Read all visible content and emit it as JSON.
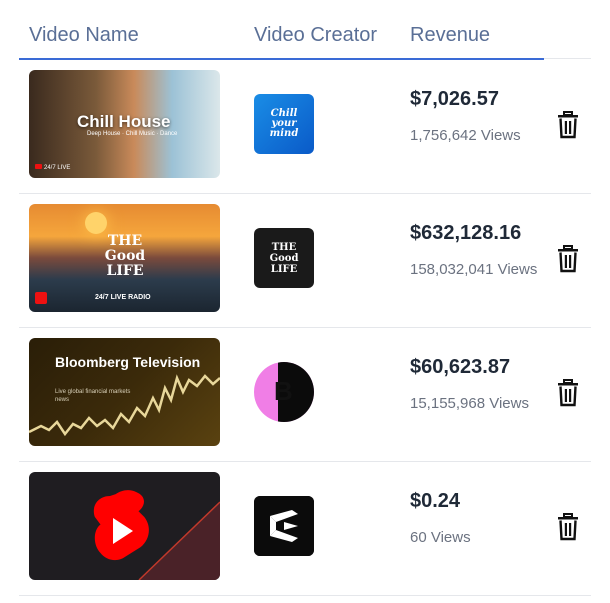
{
  "header": {
    "video_name": "Video Name",
    "video_creator": "Video Creator",
    "revenue": "Revenue"
  },
  "rows": [
    {
      "thumb_title": "Chill House",
      "thumb_sub": "Deep House · Chill Music · Dance",
      "thumb_live": "24/7 LIVE",
      "creator_logo_text": "Chill your mind",
      "revenue": "$7,026.57",
      "views": "1,756,642 Views"
    },
    {
      "thumb_title": "THE Good LIFE",
      "thumb_live": "24/7 LIVE RADIO",
      "creator_logo_text": "THE Good LIFE",
      "revenue": "$632,128.16",
      "views": "158,032,041 Views"
    },
    {
      "thumb_title": "Bloomberg Television",
      "thumb_sub": "Live global financial markets news",
      "creator_logo_text": "B",
      "revenue": "$60,623.87",
      "views": "15,155,968 Views"
    },
    {
      "thumb_icon": "youtube-shorts-icon",
      "creator_logo_icon": "capcut-icon",
      "revenue": "$0.24",
      "views": "60 Views"
    }
  ],
  "icons": {
    "delete": "trash-icon"
  },
  "colors": {
    "header_text": "#5a6f96",
    "header_underline": "#3a6bd6",
    "revenue_text": "#1f2937",
    "views_text": "#6b7280",
    "bloomberg_pink": "#f07ee6",
    "shorts_red": "#ff0000"
  }
}
